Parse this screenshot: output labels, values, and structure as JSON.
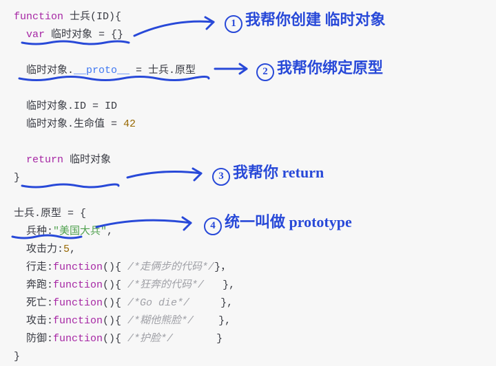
{
  "code": {
    "l1a": "function",
    "l1b": " 士兵(ID){",
    "l2a": "  var",
    "l2b": " 临时对象 = {}",
    "blank1": "",
    "l3": "  临时对象.",
    "l3b": "__proto__",
    "l3c": " = 士兵.原型",
    "blank2": "",
    "l4": "  临时对象.ID = ID",
    "l5a": "  临时对象.生命值 = ",
    "l5b": "42",
    "blank3": "",
    "l6a": "  return",
    "l6b": " 临时对象",
    "l7": "}",
    "blank4": "",
    "l8": "士兵.原型 = {",
    "l9a": "  兵种:",
    "l9b": "\"美国大兵\"",
    "l9c": ",",
    "l10a": "  攻击力:",
    "l10b": "5",
    "l10c": ",",
    "l11a": "  行走:",
    "l11b": "function",
    "l11c": "(){ ",
    "l11d": "/*走俩步的代码*/",
    "l11e": "}，",
    "l12a": "  奔跑:",
    "l12b": "function",
    "l12c": "(){ ",
    "l12d": "/*狂奔的代码*/",
    "l12e": "   },",
    "l13a": "  死亡:",
    "l13b": "function",
    "l13c": "(){ ",
    "l13d": "/*Go die*/",
    "l13e": "     },",
    "l14a": "  攻击:",
    "l14b": "function",
    "l14c": "(){ ",
    "l14d": "/*糊他熊脸*/",
    "l14e": "    },",
    "l15a": "  防御:",
    "l15b": "function",
    "l15c": "(){ ",
    "l15d": "/*护脸*/",
    "l15e": "       }",
    "l16": "}"
  },
  "notes": {
    "n1_num": "1",
    "n1": "我帮你创建 临时对象",
    "n2_num": "2",
    "n2": "我帮你绑定原型",
    "n3_num": "3",
    "n3": "我帮你 return",
    "n4_num": "4",
    "n4": "统一叫做 prototype"
  }
}
